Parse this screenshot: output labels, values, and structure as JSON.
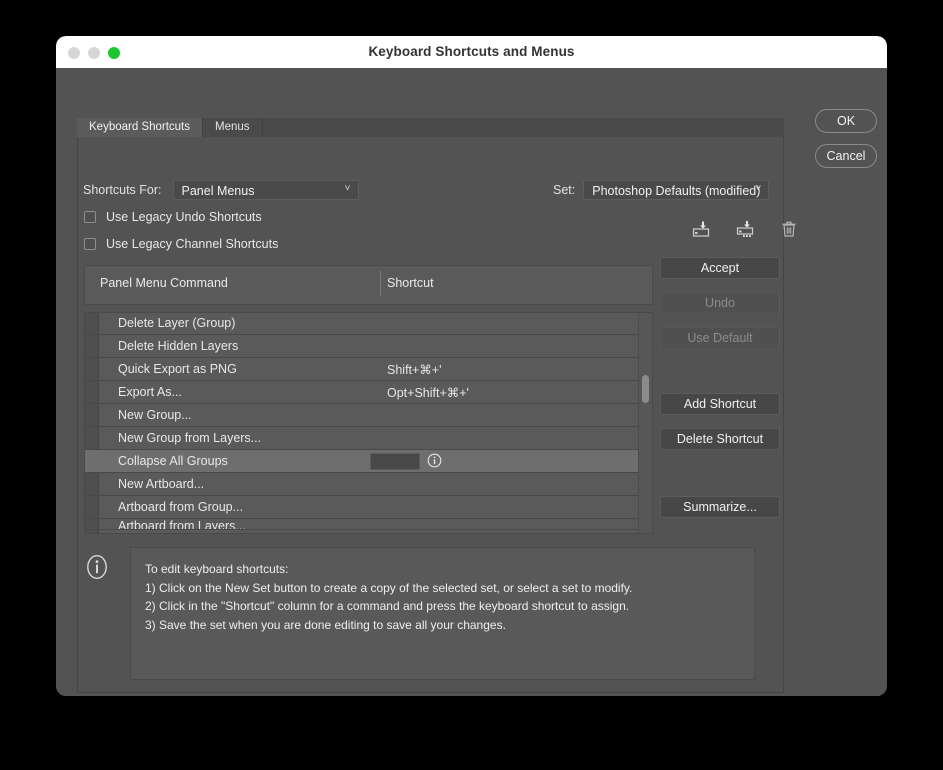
{
  "window": {
    "title": "Keyboard Shortcuts and Menus",
    "traffic_lights": {
      "close": "close-button",
      "minimize": "minimize-button",
      "zoom": "zoom-button"
    }
  },
  "tabs": [
    {
      "label": "Keyboard Shortcuts",
      "active": true
    },
    {
      "label": "Menus",
      "active": false
    }
  ],
  "form": {
    "shortcuts_for_label": "Shortcuts For:",
    "shortcuts_for_value": "Panel Menus",
    "set_label": "Set:",
    "set_value": "Photoshop Defaults (modified)",
    "chevron": "˅"
  },
  "checkboxes": [
    {
      "label": "Use Legacy Undo Shortcuts",
      "checked": false
    },
    {
      "label": "Use Legacy Channel Shortcuts",
      "checked": false
    }
  ],
  "set_tools": [
    {
      "name": "save-as-new-set-icon",
      "tooltip": "Create a new set based on the current set of shortcuts"
    },
    {
      "name": "save-set-icon",
      "tooltip": "Save all changes to the current set of shortcuts"
    },
    {
      "name": "delete-set-icon",
      "tooltip": "Delete the current set of shortcuts"
    }
  ],
  "table": {
    "columns": [
      "Panel Menu Command",
      "Shortcut"
    ],
    "rows": [
      {
        "command": "Delete Layer (Group)",
        "shortcut": "",
        "selected": false
      },
      {
        "command": "Delete Hidden Layers",
        "shortcut": "",
        "selected": false
      },
      {
        "command": "Quick Export as PNG",
        "shortcut": "Shift+⌘+'",
        "selected": false
      },
      {
        "command": "Export As...",
        "shortcut": "Opt+Shift+⌘+'",
        "selected": false
      },
      {
        "command": "New Group...",
        "shortcut": "",
        "selected": false
      },
      {
        "command": "New Group from Layers...",
        "shortcut": "",
        "selected": false
      },
      {
        "command": "Collapse All Groups",
        "shortcut": "",
        "selected": true,
        "editing": true
      },
      {
        "command": "New Artboard...",
        "shortcut": "",
        "selected": false
      },
      {
        "command": "Artboard from Group...",
        "shortcut": "",
        "selected": false
      },
      {
        "command": "Artboard from Layers...",
        "shortcut": "",
        "selected": false,
        "clipped": true
      }
    ]
  },
  "buttons": {
    "accept": {
      "label": "Accept",
      "enabled": true
    },
    "undo": {
      "label": "Undo",
      "enabled": false
    },
    "use_default": {
      "label": "Use Default",
      "enabled": false
    },
    "add_shortcut": {
      "label": "Add Shortcut",
      "enabled": true
    },
    "delete_shortcut": {
      "label": "Delete Shortcut",
      "enabled": true
    },
    "summarize": {
      "label": "Summarize...",
      "enabled": true
    },
    "ok": {
      "label": "OK",
      "enabled": true
    },
    "cancel": {
      "label": "Cancel",
      "enabled": true
    }
  },
  "instructions": {
    "icon": "info-icon",
    "lines": [
      "To edit keyboard shortcuts:",
      "1) Click on the New Set button to create a copy of the selected set, or select a set to modify.",
      "2) Click in the \"Shortcut\" column for a command and press the keyboard shortcut to assign.",
      "3) Save the set when you are done editing to save all your changes."
    ]
  },
  "colors": {
    "window_bg": "#535353",
    "titlebar_bg": "#ffffff",
    "panel_bg": "#5a5a5a",
    "row_selected": "#6e6e6e",
    "text": "#e8e8e8",
    "zoom_light": "#1ec630"
  }
}
